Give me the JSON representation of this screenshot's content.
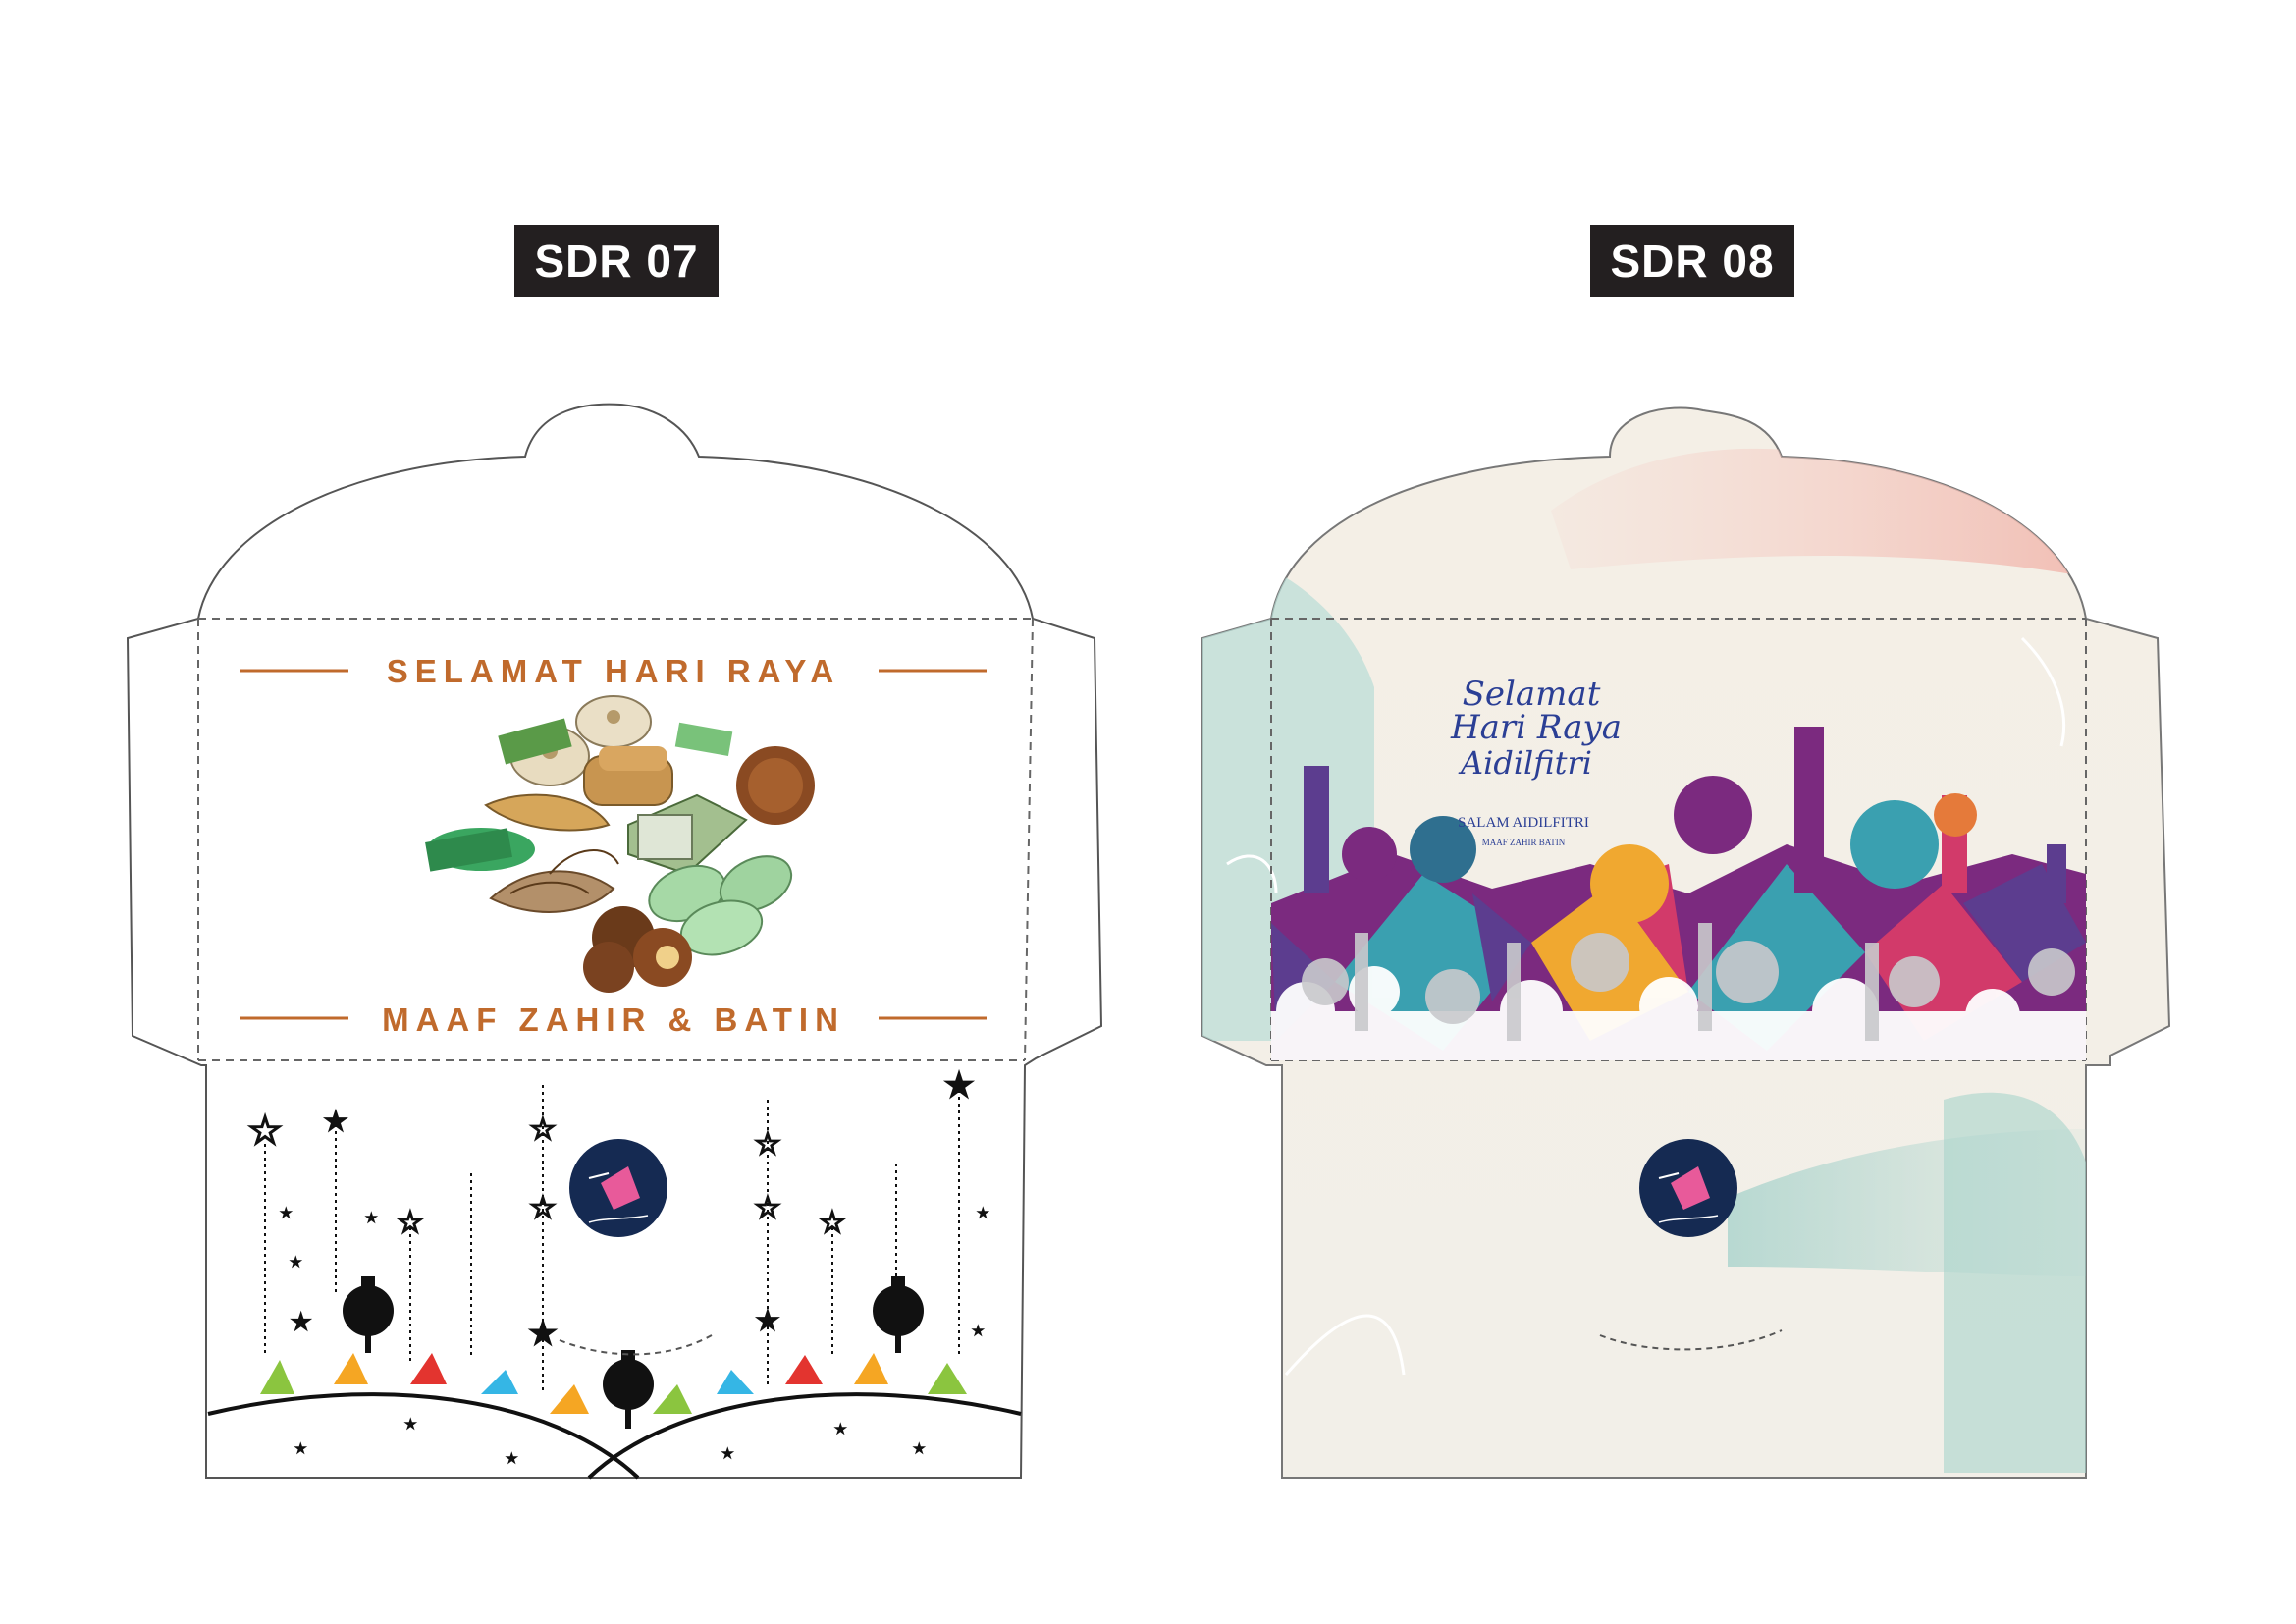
{
  "labels": {
    "left": "SDR 07",
    "right": "SDR 08"
  },
  "left_envelope": {
    "greeting_top": "SELAMAT HARI RAYA",
    "greeting_bottom": "MAAF ZAHIR & BATIN",
    "accent_color": "#c06a2c",
    "bunting_colors": [
      "#8bc53f",
      "#f5a623",
      "#e3342f",
      "#35b6e5"
    ]
  },
  "right_envelope": {
    "calligraphy_lines": [
      "Selamat",
      "Hari Raya",
      "Aidilfitri"
    ],
    "subtitle": "SALAM AIDILFITRI",
    "subtitle_small": "MAAF ZAHIR BATIN",
    "accent_color": "#2b3f95",
    "mosque_colors": [
      "#7b2a7f",
      "#3aa0b0",
      "#f0a830",
      "#d23a6a",
      "#5c3d8f"
    ]
  }
}
